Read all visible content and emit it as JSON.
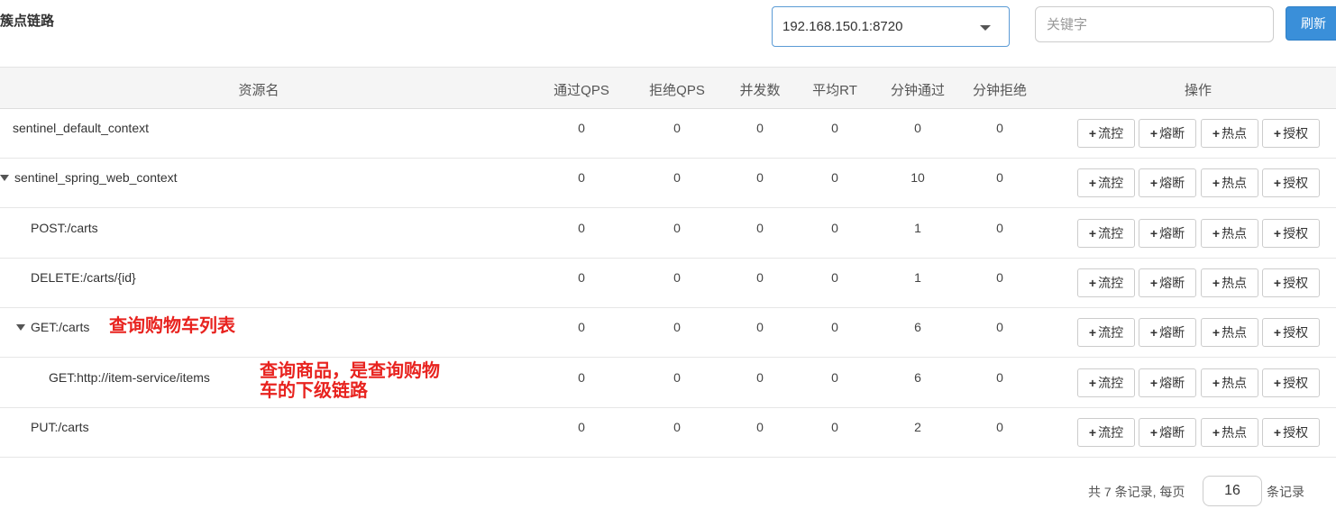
{
  "page": {
    "title": "簇点链路"
  },
  "toolbar": {
    "machine_selected": "192.168.150.1:8720",
    "search_placeholder": "关键字",
    "refresh_label": "刷新"
  },
  "table": {
    "columns": [
      "资源名",
      "通过QPS",
      "拒绝QPS",
      "并发数",
      "平均RT",
      "分钟通过",
      "分钟拒绝",
      "操作"
    ],
    "action_labels": [
      "流控",
      "熔断",
      "热点",
      "授权"
    ],
    "rows": [
      {
        "name": "sentinel_default_context",
        "expanded": false,
        "values": [
          "0",
          "0",
          "0",
          "0",
          "0",
          "0"
        ]
      },
      {
        "name": "sentinel_spring_web_context",
        "expanded": true,
        "values": [
          "0",
          "0",
          "0",
          "0",
          "10",
          "0"
        ]
      },
      {
        "name": "POST:/carts",
        "expanded": false,
        "values": [
          "0",
          "0",
          "0",
          "0",
          "1",
          "0"
        ]
      },
      {
        "name": "DELETE:/carts/{id}",
        "expanded": false,
        "values": [
          "0",
          "0",
          "0",
          "0",
          "1",
          "0"
        ]
      },
      {
        "name": "GET:/carts",
        "expanded": true,
        "values": [
          "0",
          "0",
          "0",
          "0",
          "6",
          "0"
        ]
      },
      {
        "name": "GET:http://item-service/items",
        "expanded": false,
        "values": [
          "0",
          "0",
          "0",
          "0",
          "6",
          "0"
        ]
      },
      {
        "name": "PUT:/carts",
        "expanded": false,
        "values": [
          "0",
          "0",
          "0",
          "0",
          "2",
          "0"
        ]
      }
    ]
  },
  "annotations": {
    "get_carts": "查询购物车列表",
    "get_items_line1": "查询商品，是查询购物",
    "get_items_line2": "车的下级链路"
  },
  "pagination": {
    "summary": "共 7 条记录, 每页",
    "page_size": "16",
    "suffix": "条记录"
  },
  "colors": {
    "accent": "#3a8fd9",
    "annotation": "#e8231f",
    "header_bg": "#f5f5f5"
  }
}
